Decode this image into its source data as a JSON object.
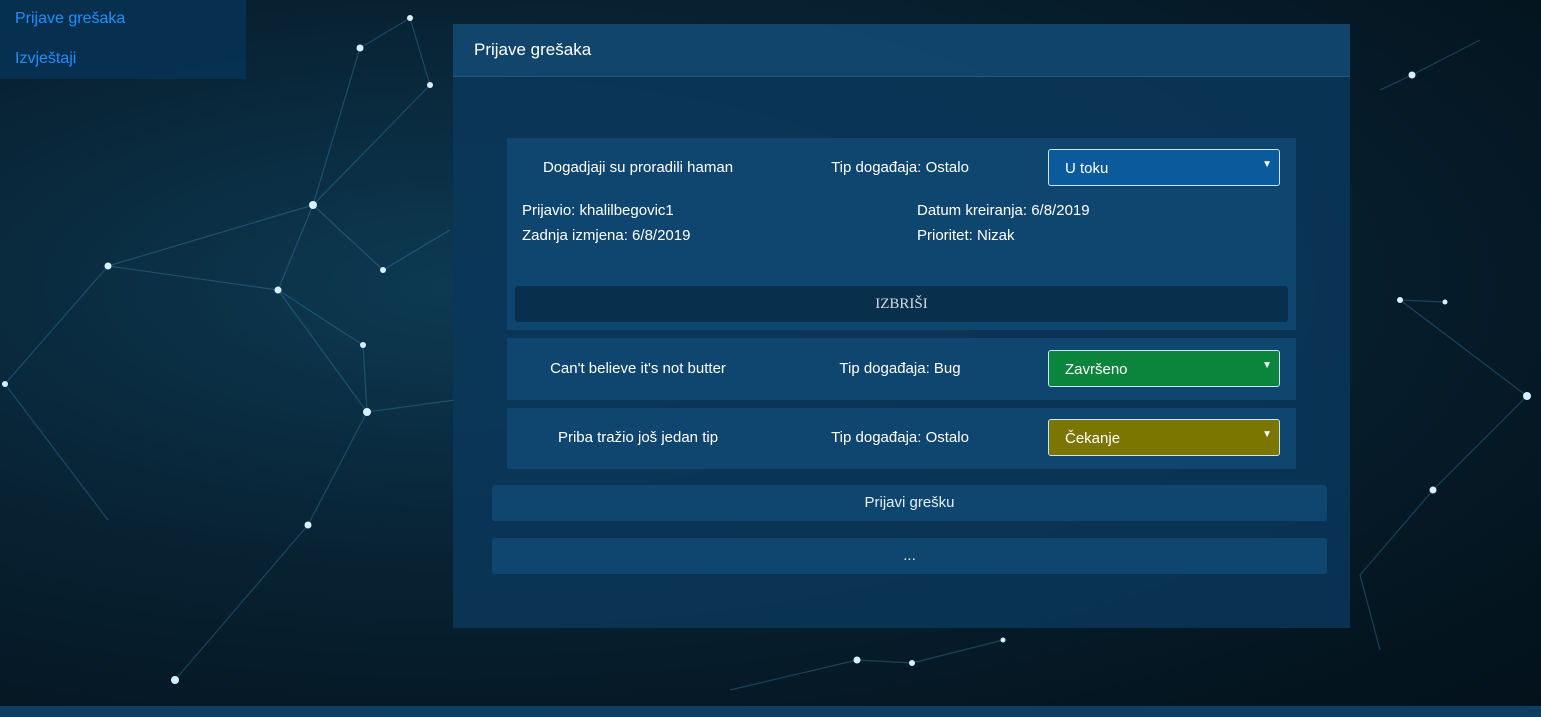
{
  "sidebar": {
    "items": [
      {
        "label": "Prijave grešaka"
      },
      {
        "label": "Izvještaji"
      }
    ]
  },
  "panel": {
    "title": "Prijave grešaka"
  },
  "reports": [
    {
      "name": "Dogadjaji su proradili haman",
      "type": "Tip događaja: Ostalo",
      "status": "U toku",
      "status_color": "#0a5a9c",
      "reported_by": "Prijavio: khalilbegovic1",
      "last_modified": "Zadnja izmjena: 6/8/2019",
      "created": "Datum kreiranja: 6/8/2019",
      "priority": "Prioritet: Nizak",
      "delete_label": "IZBRIŠI"
    },
    {
      "name": "Can't believe it's not butter",
      "type": "Tip događaja: Bug",
      "status": "Završeno",
      "status_color": "#0b843c"
    },
    {
      "name": "Priba tražio još jedan tip",
      "type": "Tip događaja: Ostalo",
      "status": "Čekanje",
      "status_color": "#7a7600"
    }
  ],
  "actions": {
    "report_label": "Prijavi grešku",
    "more_label": "..."
  },
  "colors": {
    "link": "#1e8fff",
    "card_bg": "#0f4670",
    "panel_bg": "#0a375a"
  },
  "icons": {
    "dropdown": "caret-down-icon"
  }
}
